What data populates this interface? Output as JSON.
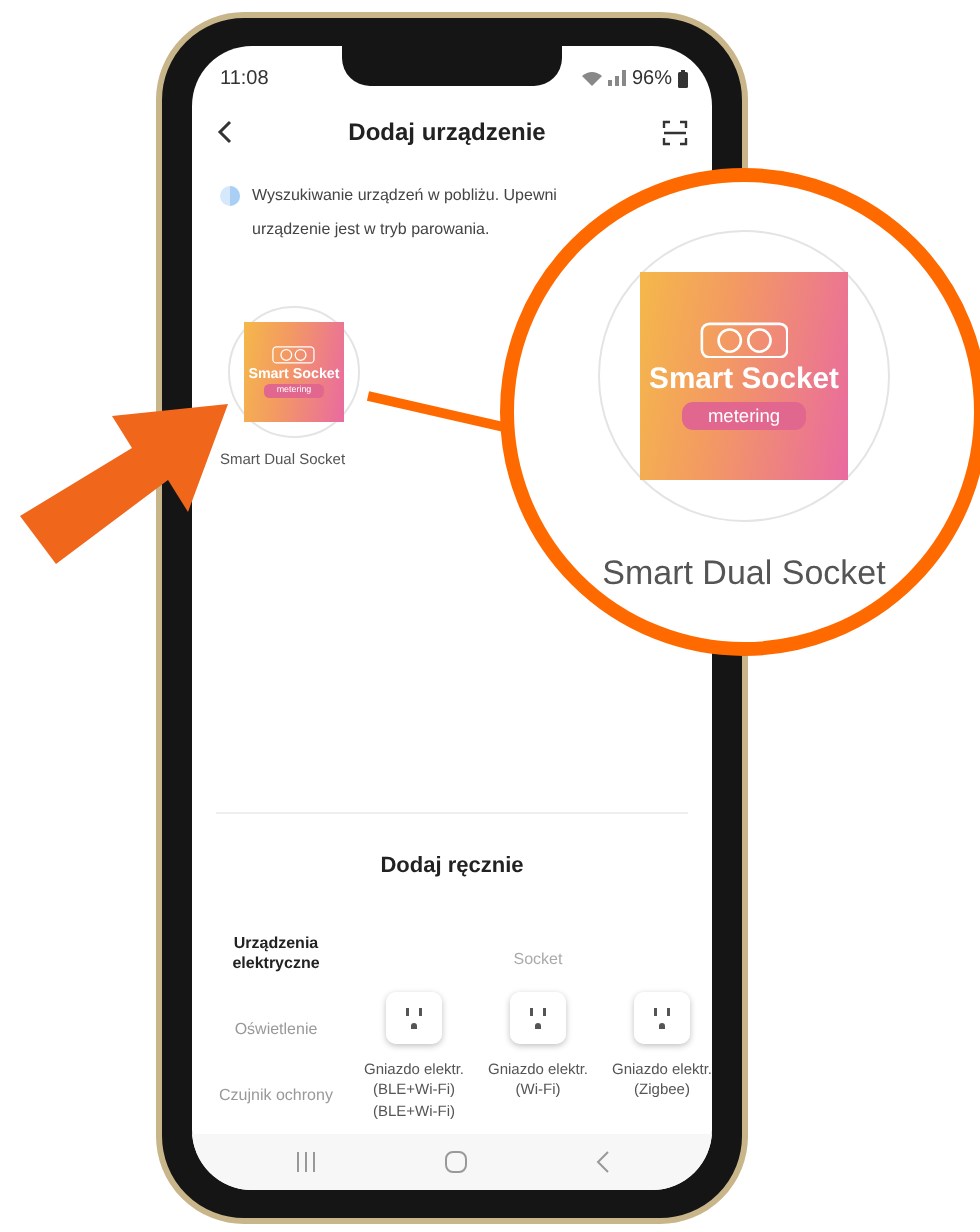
{
  "status_bar": {
    "time": "11:08",
    "battery": "96%"
  },
  "header": {
    "title": "Dodaj urządzenie"
  },
  "scanning": {
    "lines": [
      "Wyszukiwanie urządzeń w pobliżu. Upewni",
      "urządzenie jest w tryb parowania."
    ]
  },
  "found_devices": [
    {
      "name": "Smart Dual Socket",
      "image": {
        "title": "Smart Socket",
        "badge": "metering"
      }
    }
  ],
  "callout": {
    "name": "Smart Dual Socket",
    "image": {
      "title": "Smart Socket",
      "badge": "metering"
    }
  },
  "manual": {
    "title": "Dodaj ręcznie",
    "categories": [
      {
        "label": "Urządzenia elektryczne",
        "selected": true
      },
      {
        "label": "Oświetlenie",
        "selected": false
      },
      {
        "label": "Czujnik ochrony",
        "selected": false
      }
    ],
    "group_title": "Socket",
    "devices": [
      {
        "name": "Gniazdo elektr. (BLE+Wi-Fi) (BLE+Wi-Fi)"
      },
      {
        "name": "Gniazdo elektr. (Wi-Fi)"
      },
      {
        "name": "Gniazdo elektr. (Zigbee)"
      }
    ]
  }
}
